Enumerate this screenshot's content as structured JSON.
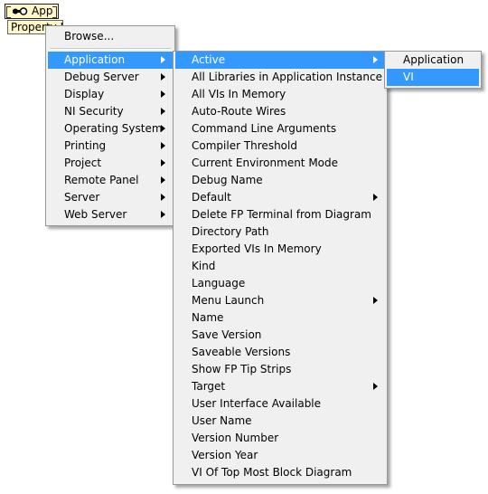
{
  "node": {
    "ref_label": "App",
    "prop_label": "Property Node"
  },
  "menu_root": {
    "browse": "Browse...",
    "items": [
      {
        "label": "Application",
        "has_submenu": true,
        "active": true
      },
      {
        "label": "Debug Server",
        "has_submenu": true
      },
      {
        "label": "Display",
        "has_submenu": true
      },
      {
        "label": "NI Security",
        "has_submenu": true
      },
      {
        "label": "Operating System",
        "has_submenu": true
      },
      {
        "label": "Printing",
        "has_submenu": true
      },
      {
        "label": "Project",
        "has_submenu": true
      },
      {
        "label": "Remote Panel",
        "has_submenu": true
      },
      {
        "label": "Server",
        "has_submenu": true
      },
      {
        "label": "Web Server",
        "has_submenu": true
      }
    ]
  },
  "menu_application": {
    "items": [
      {
        "label": "Active",
        "has_submenu": true,
        "active": true
      },
      {
        "label": "All Libraries in Application Instance"
      },
      {
        "label": "All VIs In Memory"
      },
      {
        "label": "Auto-Route Wires"
      },
      {
        "label": "Command Line Arguments"
      },
      {
        "label": "Compiler Threshold"
      },
      {
        "label": "Current Environment Mode"
      },
      {
        "label": "Debug Name"
      },
      {
        "label": "Default",
        "has_submenu": true
      },
      {
        "label": "Delete FP Terminal from Diagram"
      },
      {
        "label": "Directory Path"
      },
      {
        "label": "Exported VIs In Memory"
      },
      {
        "label": "Kind"
      },
      {
        "label": "Language"
      },
      {
        "label": "Menu Launch",
        "has_submenu": true
      },
      {
        "label": "Name"
      },
      {
        "label": "Save Version"
      },
      {
        "label": "Saveable Versions"
      },
      {
        "label": "Show FP Tip Strips"
      },
      {
        "label": "Target",
        "has_submenu": true
      },
      {
        "label": "User Interface Available"
      },
      {
        "label": "User Name"
      },
      {
        "label": "Version Number"
      },
      {
        "label": "Version Year"
      },
      {
        "label": "VI Of Top Most Block Diagram"
      }
    ]
  },
  "menu_active": {
    "items": [
      {
        "label": "Application"
      },
      {
        "label": "VI",
        "active": true
      }
    ]
  },
  "colors": {
    "highlight": "#3399ff",
    "menu_bg": "#f0f0f0",
    "node_bg": "#fff7c8"
  }
}
